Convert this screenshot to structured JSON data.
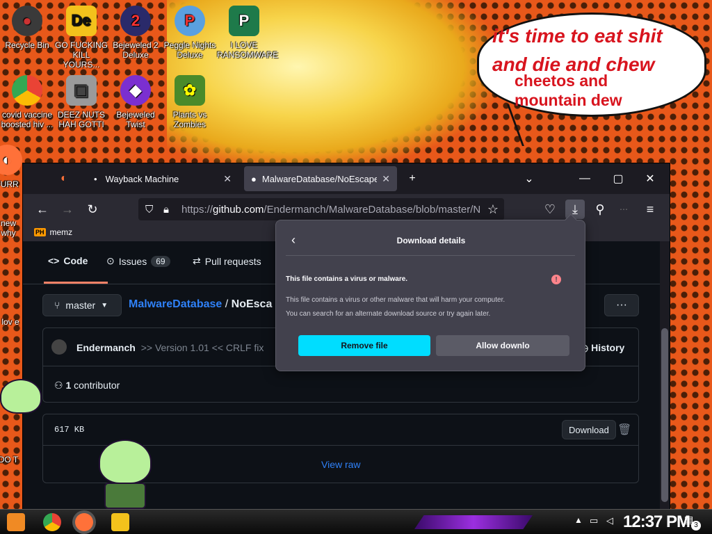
{
  "wallpaper": {
    "bubble_line1": "it's time to eat shit",
    "bubble_line2": "and die and chew",
    "bubble_line3": "cheetos and",
    "bubble_line4": "mountain dew"
  },
  "desktop_icons": [
    {
      "label": "Recycle Bin"
    },
    {
      "label": "GO FUCKING KILL YOURS..."
    },
    {
      "label": "Bejeweled 2 Deluxe"
    },
    {
      "label": "Peggle Nights Deluxe"
    },
    {
      "label": "I LOVE RANSOMWARE"
    },
    {
      "label": "covid vaccine boosted hiv ..."
    },
    {
      "label": "DEEZ NUTS HAH GOTTI"
    },
    {
      "label": "Bejeweled Twist"
    },
    {
      "label": "Plants vs Zombies"
    },
    {
      "label": "FURR"
    },
    {
      "label": "new why"
    },
    {
      "label": "i lov e"
    },
    {
      "label": "DO"
    },
    {
      "label": "DO T"
    }
  ],
  "browser": {
    "tabs": [
      {
        "label": "Wayback Machine",
        "close": "✕"
      },
      {
        "label": "MalwareDatabase/NoEscape.e",
        "close": "✕"
      }
    ],
    "new_tab": "+",
    "url_prefix": "https://",
    "url_host": "github.com",
    "url_path": "/Endermanch/MalwareDatabase/blob/master/N",
    "bookmark": "memz",
    "bookmark_icon_text": "PH"
  },
  "github": {
    "tab_code": "Code",
    "tab_issues": "Issues",
    "issues_count": "69",
    "tab_pulls": "Pull requests",
    "branch": "master",
    "repo_link": "MalwareDatabase",
    "separator": "/",
    "repo_file": "NoEsca",
    "commit_author": "Endermanch",
    "commit_message": ">> Version 1.01 << CRLF fix",
    "history": "History",
    "contributors_count": "1",
    "contributors_label": "contributor",
    "file_size": "617 KB",
    "download": "Download",
    "view_raw": "View raw"
  },
  "download_popup": {
    "title": "Download details",
    "heading": "This file contains a virus or malware.",
    "body_line1": "This file contains a virus or other malware that will harm your computer.",
    "body_line2": "You can search for an alternate download source or try again later.",
    "remove_button": "Remove file",
    "allow_button": "Allow downlo"
  },
  "taskbar": {
    "time": "12:37 PM",
    "notification_count": "3"
  },
  "colors": {
    "accent_button": "#00ddff",
    "github_link": "#2f81f7",
    "warning_red": "#ff848b"
  }
}
